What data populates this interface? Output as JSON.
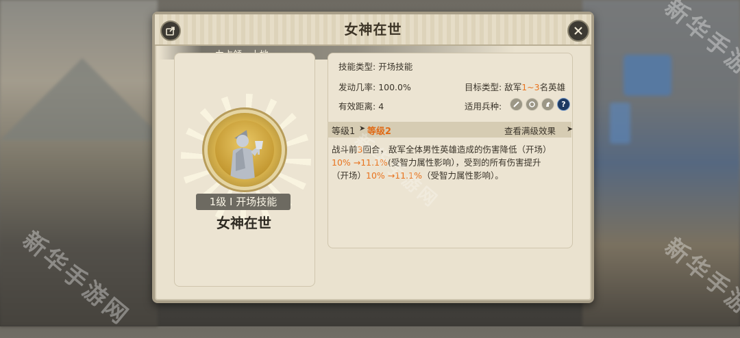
{
  "window": {
    "title": "女神在世"
  },
  "banner": {
    "text_before": "力占领",
    "text_highlight": "一",
    "text_after": "土地。"
  },
  "skill": {
    "level_label": "1级 I 开场技能",
    "name": "女神在世",
    "icon_name": "goddess-statue-icon",
    "skill_type_label": "技能类型:",
    "skill_type_value": "开场技能",
    "trigger_rate_label": "发动几率:",
    "trigger_rate_value": "100.0%",
    "range_label": "有效距离:",
    "range_value": "4",
    "target_type_label": "目标类型:",
    "target_type_prefix": "敌军",
    "target_type_count": "1~3",
    "target_type_suffix": "名英雄",
    "troop_type_label": "适用兵种:",
    "troop_icons": [
      "sword-icon",
      "shield-ring-icon",
      "horse-icon",
      "question-icon"
    ]
  },
  "level_bar": {
    "current": "等级1",
    "next": "等级2",
    "view_full": "查看满级效果"
  },
  "description": {
    "p1_a": "战斗前",
    "p1_num": "3",
    "p1_b": "回合，敌军全体男性英雄造成的伤害降低（开场）",
    "p2_val": "10% →11.1%",
    "p2_b": "(受智力属性影响），受到的所有伤害提升",
    "p3_a": "（开场）",
    "p3_val": "10% →11.1%",
    "p3_b": "（受智力属性影响）。"
  },
  "watermark": "新华手游网",
  "colors": {
    "accent": "#e8731e",
    "panel": "#eae2cf",
    "badge": "#6d6a61"
  }
}
